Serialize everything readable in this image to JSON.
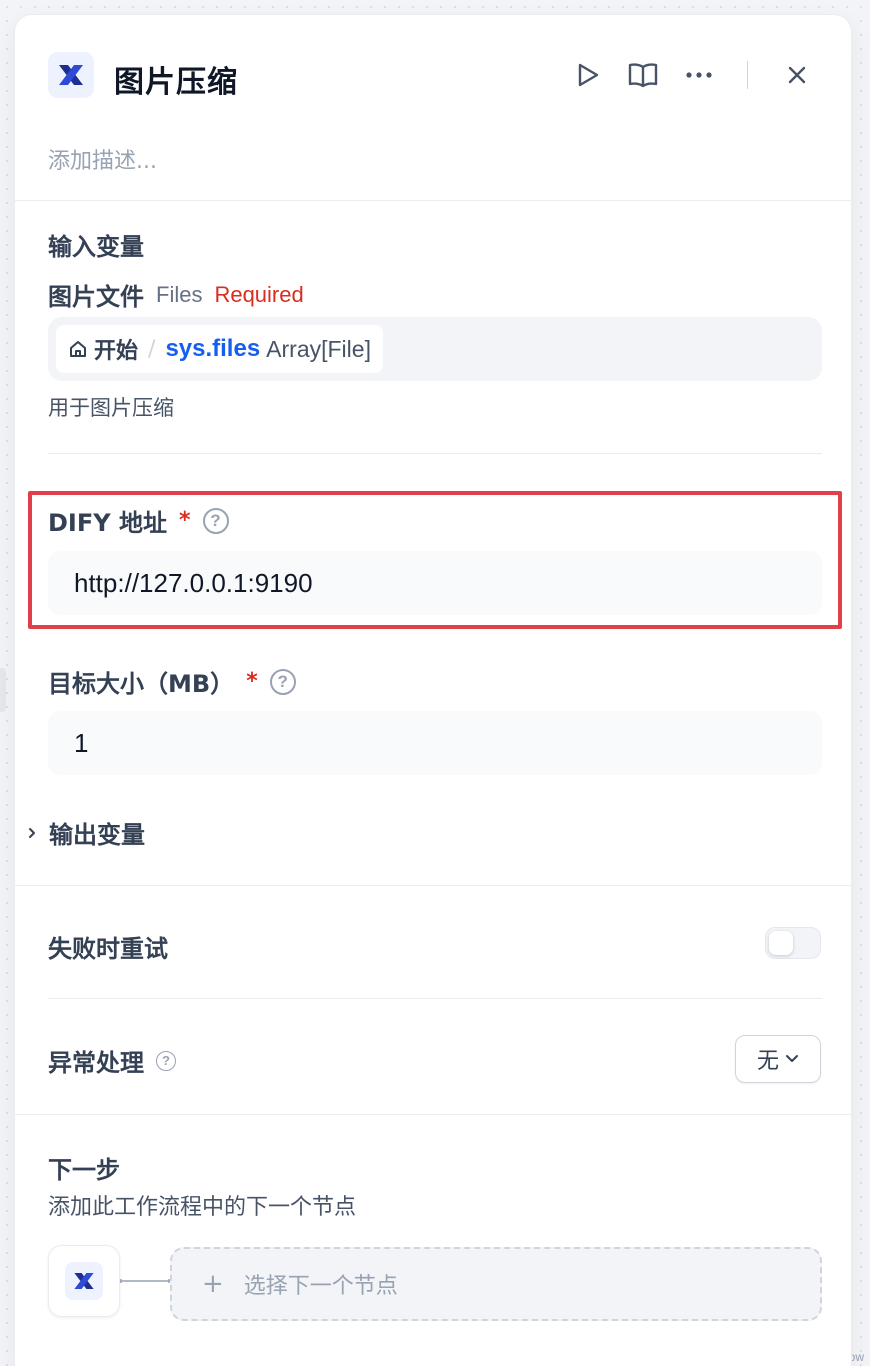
{
  "node": {
    "title": "图片压缩",
    "description_placeholder": "添加描述..."
  },
  "inputs": {
    "section_title": "输入变量",
    "files_field": {
      "label": "图片文件",
      "type": "Files",
      "required": "Required",
      "chip_source": "开始",
      "chip_separator": "/",
      "chip_variable": "sys.files",
      "chip_type": "Array[File]",
      "hint": "用于图片压缩"
    },
    "dify_field": {
      "label": "DIFY 地址",
      "asterisk": "*",
      "value": "http://127.0.0.1:9190"
    },
    "size_field": {
      "label": "目标大小（MB）",
      "asterisk": "*",
      "value": "1"
    }
  },
  "outputs": {
    "section_title": "输出变量"
  },
  "retry": {
    "label": "失败时重试",
    "enabled": false
  },
  "error_handling": {
    "label": "异常处理",
    "selected": "无"
  },
  "next_step": {
    "title": "下一步",
    "subtitle": "添加此工作流程中的下一个节点",
    "add_label": "选择下一个节点",
    "add_icon": "+"
  },
  "canvas": {
    "corner_text": "ow"
  },
  "colors": {
    "accent": "#155eef",
    "required": "#d92d20",
    "highlight_border": "#e0404a"
  }
}
